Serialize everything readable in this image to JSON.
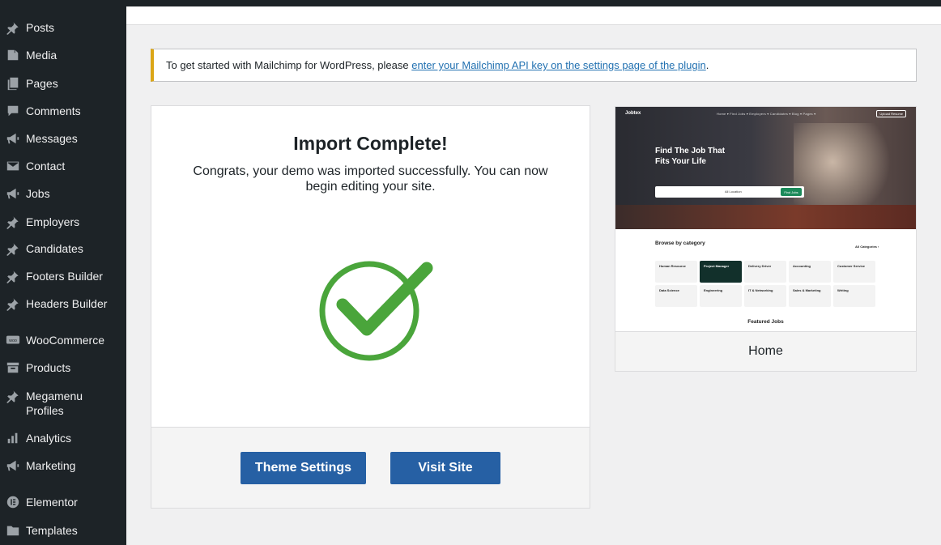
{
  "sidebar": {
    "items": [
      {
        "label": "Posts",
        "icon": "pin-icon"
      },
      {
        "label": "Media",
        "icon": "media-icon"
      },
      {
        "label": "Pages",
        "icon": "pages-icon"
      },
      {
        "label": "Comments",
        "icon": "comment-icon"
      },
      {
        "label": "Messages",
        "icon": "megaphone-icon"
      },
      {
        "label": "Contact",
        "icon": "mail-icon"
      },
      {
        "label": "Jobs",
        "icon": "megaphone-icon"
      },
      {
        "label": "Employers",
        "icon": "pin-icon"
      },
      {
        "label": "Candidates",
        "icon": "pin-icon"
      },
      {
        "label": "Footers Builder",
        "icon": "pin-icon"
      },
      {
        "label": "Headers Builder",
        "icon": "pin-icon"
      },
      {
        "label": "WooCommerce",
        "icon": "woo-icon"
      },
      {
        "label": "Products",
        "icon": "archive-icon"
      },
      {
        "label": "Megamenu Profiles",
        "label_line2": "Profiles",
        "icon": "pin-icon"
      },
      {
        "label": "Analytics",
        "icon": "bar-chart-icon"
      },
      {
        "label": "Marketing",
        "icon": "megaphone-icon"
      },
      {
        "label": "Elementor",
        "icon": "elementor-icon"
      },
      {
        "label": "Templates",
        "icon": "folder-icon"
      }
    ],
    "megamenu_line1": "Megamenu",
    "megamenu_line2": "Profiles"
  },
  "notice": {
    "text_before": "To get started with Mailchimp for WordPress, please ",
    "link_text": "enter your Mailchimp API key on the settings page of the plugin",
    "text_after": "."
  },
  "import": {
    "title": "Import Complete!",
    "message": "Congrats, your demo was imported successfully. You can now begin editing your site.",
    "theme_settings_label": "Theme Settings",
    "visit_site_label": "Visit Site"
  },
  "preview": {
    "label": "Home",
    "site": {
      "logo": "Jobtex",
      "nav": "Home ▾   Find Jobs ▾   Employers ▾   Candidates ▾   Blog ▾   Pages ▾",
      "button": "Upload Resume",
      "headline_line1": "Find The Job That",
      "headline_line2": "Fits Your Life",
      "search_location": "All Location",
      "search_button": "Find Jobs",
      "section_title": "Browse by category",
      "all_categories": "All Categories ›",
      "featured": "Featured Jobs",
      "categories": [
        "Human Resource",
        "Project Manager",
        "Delivery Driver",
        "Accounting",
        "Customer Service",
        "Data Science",
        "Engineering",
        "IT & Networking",
        "Sales & Marketing",
        "Writing"
      ]
    }
  },
  "colors": {
    "sidebar_bg": "#1d2327",
    "primary_button": "#2660a4",
    "success_green": "#4aa53b",
    "notice_accent": "#dba617"
  }
}
